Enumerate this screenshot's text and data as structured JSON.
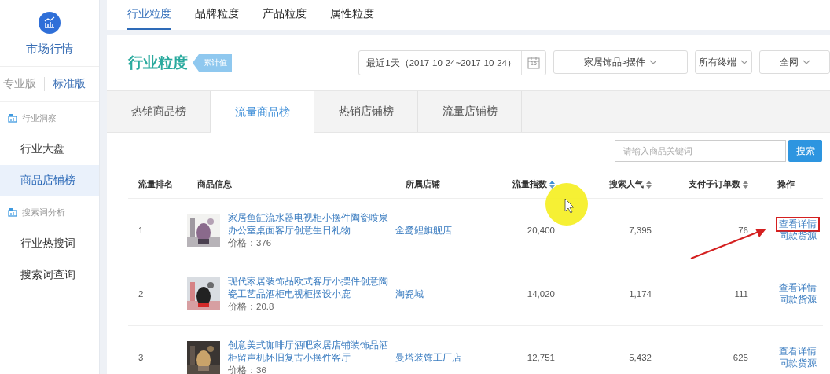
{
  "sidebar": {
    "title": "市场行情",
    "versions": [
      {
        "label": "专业版",
        "selected": false
      },
      {
        "label": "标准版",
        "selected": true
      }
    ],
    "sections": [
      {
        "heading": "行业洞察",
        "items": [
          {
            "label": "行业大盘",
            "selected": false
          },
          {
            "label": "商品店铺榜",
            "selected": true
          }
        ]
      },
      {
        "heading": "搜索词分析",
        "items": [
          {
            "label": "行业热搜词",
            "selected": false
          },
          {
            "label": "搜索词查询",
            "selected": false
          }
        ]
      }
    ]
  },
  "top_tabs": [
    {
      "label": "行业粒度",
      "selected": true
    },
    {
      "label": "品牌粒度",
      "selected": false
    },
    {
      "label": "产品粒度",
      "selected": false
    },
    {
      "label": "属性粒度",
      "selected": false
    }
  ],
  "header": {
    "title": "行业粒度",
    "badge": "累计值",
    "date_range": "最近1天（2017-10-24~2017-10-24）",
    "calendar_day": "15",
    "dropdowns": [
      {
        "value": "家居饰品>摆件"
      },
      {
        "value": "所有终端"
      },
      {
        "value": "全网"
      }
    ]
  },
  "rank_tabs": [
    {
      "label": "热销商品榜",
      "selected": false
    },
    {
      "label": "流量商品榜",
      "selected": true
    },
    {
      "label": "热销店铺榜",
      "selected": false
    },
    {
      "label": "流量店铺榜",
      "selected": false
    }
  ],
  "search": {
    "placeholder": "请输入商品关键词",
    "button": "搜索"
  },
  "table": {
    "columns": [
      {
        "label": "流量排名",
        "sortable": false,
        "sort_active": false
      },
      {
        "label": "商品信息",
        "sortable": false,
        "sort_active": false
      },
      {
        "label": "所属店铺",
        "sortable": false,
        "sort_active": false
      },
      {
        "label": "流量指数",
        "sortable": true,
        "sort_active": true
      },
      {
        "label": "搜索人气",
        "sortable": true,
        "sort_active": false
      },
      {
        "label": "支付子订单数",
        "sortable": true,
        "sort_active": false
      },
      {
        "label": "操作",
        "sortable": false,
        "sort_active": false
      }
    ],
    "rows": [
      {
        "rank": "1",
        "title": "家居鱼缸流水器电视柜小摆件陶瓷喷泉办公室桌面客厅创意生日礼物",
        "price": "价格：376",
        "shop": "金鹭鲤旗舰店",
        "flow": "20,400",
        "search": "7,395",
        "orders": "76",
        "actions": [
          {
            "label": "查看详情",
            "highlighted": true
          },
          {
            "label": "同款货源",
            "highlighted": false
          }
        ]
      },
      {
        "rank": "2",
        "title": "现代家居装饰品欧式客厅小摆件创意陶瓷工艺品酒柜电视柜摆设小鹿",
        "price": "价格：20.8",
        "shop": "淘瓷城",
        "flow": "14,020",
        "search": "1,174",
        "orders": "111",
        "actions": [
          {
            "label": "查看详情",
            "highlighted": false
          },
          {
            "label": "同款货源",
            "highlighted": false
          }
        ]
      },
      {
        "rank": "3",
        "title": "创意美式咖啡厅酒吧家居店铺装饰品酒柜留声机怀旧复古小摆件客厅",
        "price": "价格：36",
        "shop": "曼塔装饰工厂店",
        "flow": "12,751",
        "search": "5,432",
        "orders": "625",
        "actions": [
          {
            "label": "查看详情",
            "highlighted": false
          },
          {
            "label": "同款货源",
            "highlighted": false
          }
        ]
      }
    ]
  },
  "annotations": {
    "cursor_highlight": true,
    "pointer_arrow": true
  }
}
